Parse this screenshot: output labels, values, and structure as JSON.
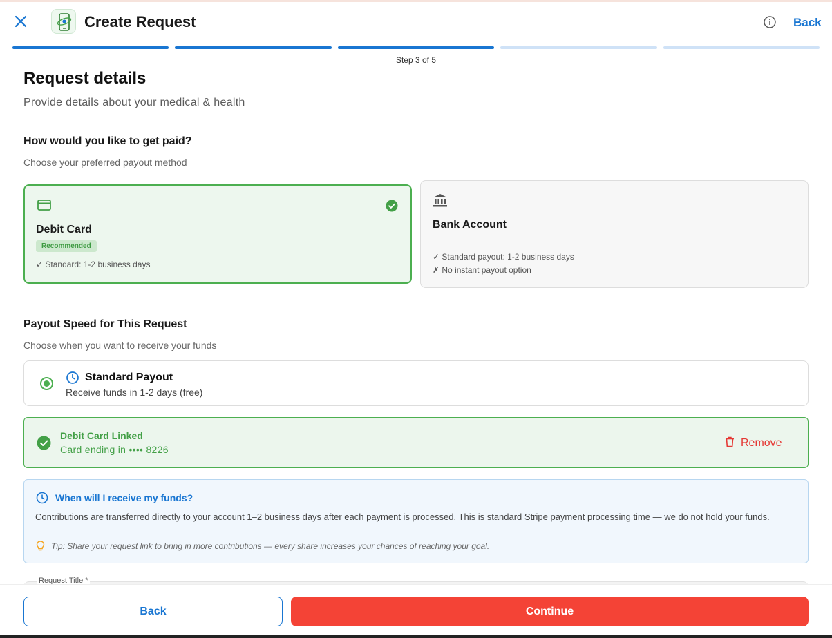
{
  "header": {
    "title": "Create Request",
    "back_label": "Back"
  },
  "progress": {
    "total_steps": 5,
    "completed_steps": 3,
    "step_label": "Step 3 of 5"
  },
  "page": {
    "title": "Request details",
    "subtitle": "Provide details about your medical & health"
  },
  "payout_method": {
    "title": "How would you like to get paid?",
    "subtitle": "Choose your preferred payout method",
    "options": [
      {
        "name": "Debit Card",
        "badge": "Recommended",
        "selected": true,
        "icon": "credit-card-icon",
        "features": [
          "✓ Standard: 1-2 business days"
        ]
      },
      {
        "name": "Bank Account",
        "selected": false,
        "icon": "bank-icon",
        "features": [
          "✓ Standard payout: 1-2  business days",
          "✗ No instant payout option"
        ]
      }
    ]
  },
  "payout_speed": {
    "title": "Payout Speed for This Request",
    "subtitle": "Choose when you want to receive your funds",
    "option_title": "Standard Payout",
    "option_desc": "Receive funds in 1-2 days (free)",
    "selected": true
  },
  "linked_card": {
    "title": "Debit Card Linked",
    "subtitle": "Card ending in •••• 8226",
    "remove_label": "Remove"
  },
  "funds_info": {
    "title": "When will I receive my funds?",
    "body": "Contributions are transferred directly to your account 1–2 business days after each payment is processed. This is standard Stripe payment processing time — we do not hold your funds.",
    "tip": "Tip: Share your request link to bring in more contributions — every share increases your chances of reaching your goal."
  },
  "form": {
    "title_field_label": "Request Title *"
  },
  "footer": {
    "back_label": "Back",
    "continue_label": "Continue"
  },
  "colors": {
    "primary_blue": "#1976d2",
    "success_green": "#4caf50",
    "danger_red": "#f44336"
  }
}
